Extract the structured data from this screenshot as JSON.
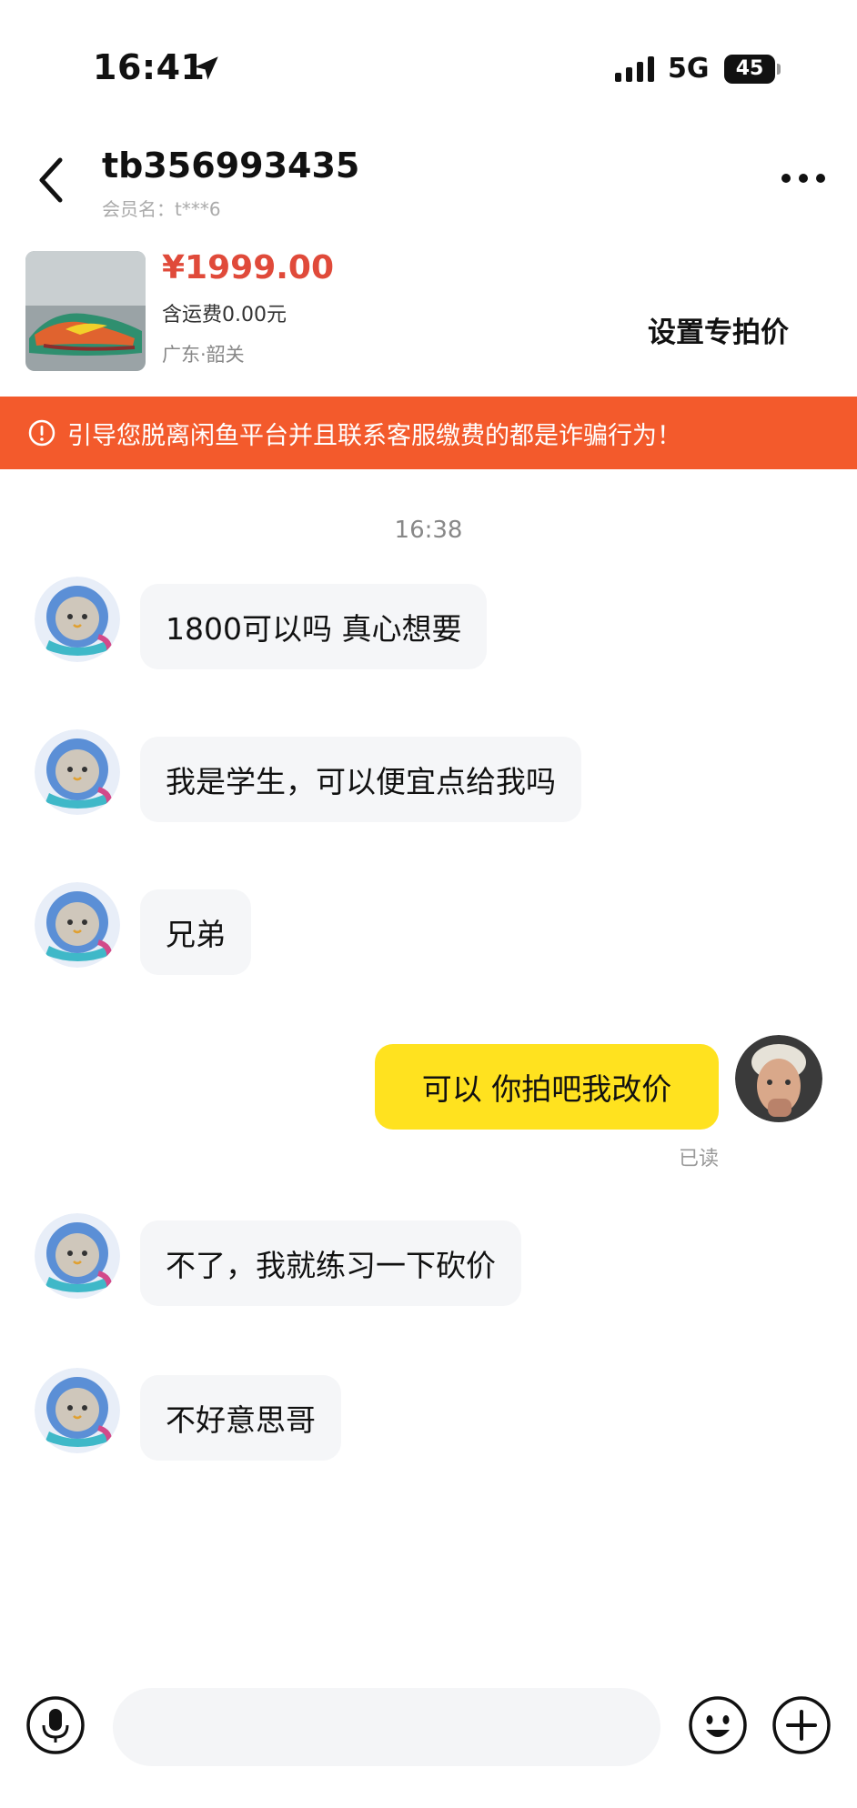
{
  "status_bar": {
    "time": "16:41",
    "network": "5G",
    "battery": "45"
  },
  "header": {
    "peer_name": "tb356993435",
    "member_label": "会员名：",
    "member_value": "t***6"
  },
  "product": {
    "price": "¥1999.00",
    "shipping": "含运费0.00元",
    "location": "广东·韶关",
    "set_price_label": "设置专拍价"
  },
  "warning": {
    "text": "引导您脱离闲鱼平台并且联系客服缴费的都是诈骗行为！",
    "color": "#f35a2c"
  },
  "chat": {
    "timestamp": "16:38",
    "messages": [
      {
        "side": "left",
        "text": "1800可以吗 真心想要"
      },
      {
        "side": "left",
        "text": "我是学生，可以便宜点给我吗"
      },
      {
        "side": "left",
        "text": "兄弟"
      },
      {
        "side": "right",
        "text": "可以  你拍吧我改价",
        "status": "已读"
      },
      {
        "side": "left",
        "text": "不了，我就练习一下砍价"
      },
      {
        "side": "left",
        "text": "不好意思哥"
      }
    ]
  },
  "input_bar": {
    "placeholder": "",
    "voice_icon": "microphone-icon",
    "emoji_icon": "smiley-icon",
    "plus_icon": "plus-icon"
  },
  "colors": {
    "price": "#e04a3a",
    "outgoing_bubble": "#ffe21f",
    "incoming_bubble": "#f5f6f8"
  }
}
